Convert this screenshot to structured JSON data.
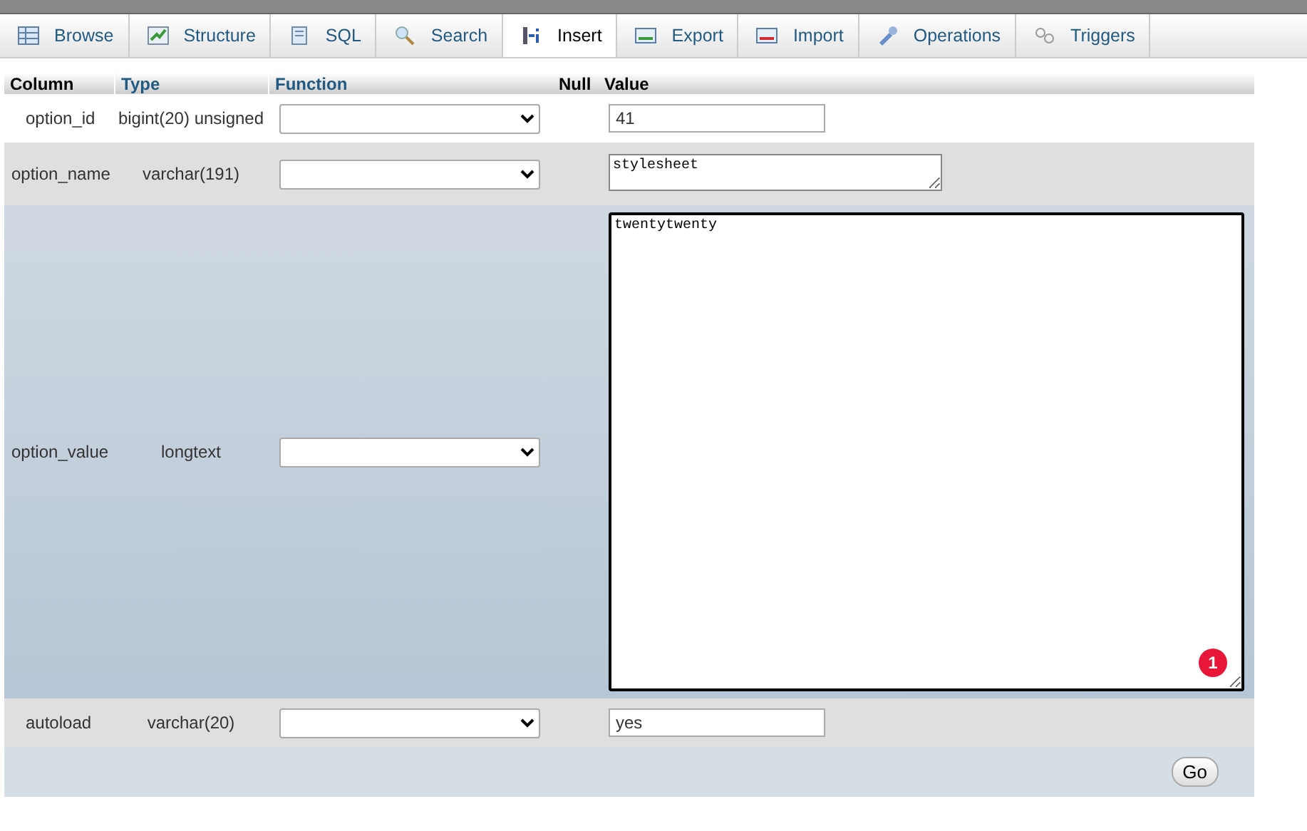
{
  "tabs": [
    {
      "label": "Browse",
      "kind": "browse",
      "selected": false
    },
    {
      "label": "Structure",
      "kind": "structure",
      "selected": false
    },
    {
      "label": "SQL",
      "kind": "sql",
      "selected": false
    },
    {
      "label": "Search",
      "kind": "search",
      "selected": false
    },
    {
      "label": "Insert",
      "kind": "insert",
      "selected": true
    },
    {
      "label": "Export",
      "kind": "export",
      "selected": false
    },
    {
      "label": "Import",
      "kind": "import",
      "selected": false
    },
    {
      "label": "Operations",
      "kind": "operations",
      "selected": false
    },
    {
      "label": "Triggers",
      "kind": "triggers",
      "selected": false
    }
  ],
  "table": {
    "columns": [
      "Column",
      "Type",
      "Function",
      "Null",
      "Value"
    ],
    "rows": [
      {
        "column": "option_id",
        "type": "bigint(20) unsigned",
        "kind": "input",
        "value": "41",
        "focused": false
      },
      {
        "column": "option_name",
        "type": "varchar(191)",
        "kind": "textarea",
        "value": "stylesheet",
        "focused": false
      },
      {
        "column": "option_value",
        "type": "longtext",
        "kind": "bigtext",
        "value": "twentytwenty",
        "focused": true,
        "badge": "1"
      },
      {
        "column": "autoload",
        "type": "varchar(20)",
        "kind": "input",
        "value": "yes",
        "focused": false
      }
    ]
  },
  "go_button": "Go"
}
